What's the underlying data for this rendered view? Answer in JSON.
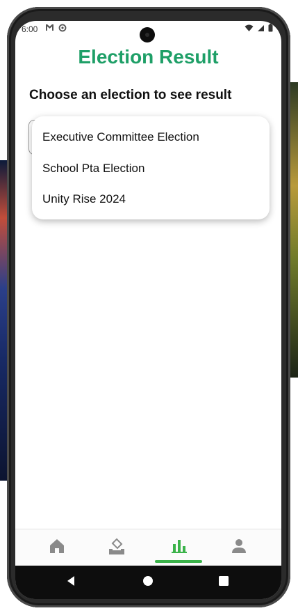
{
  "status_bar": {
    "time": "6:00",
    "left_icons": [
      "gmail-icon",
      "sync-icon"
    ],
    "right_icons": [
      "wifi-icon",
      "signal-icon",
      "battery-icon"
    ]
  },
  "header": {
    "title": "Election Result"
  },
  "main": {
    "prompt": "Choose an election to see result",
    "dropdown": {
      "options": [
        "Executive Committee Election",
        "School Pta Election",
        "Unity Rise 2024"
      ]
    }
  },
  "bottom_nav": {
    "items": [
      {
        "icon": "home-icon",
        "active": false
      },
      {
        "icon": "vote-icon",
        "active": false
      },
      {
        "icon": "bar-chart-icon",
        "active": true
      },
      {
        "icon": "person-icon",
        "active": false
      }
    ]
  },
  "system_nav": {
    "buttons": [
      "back-icon",
      "home-circle-icon",
      "recents-icon"
    ]
  },
  "colors": {
    "accent": "#1e9f67",
    "active_nav": "#3bb34a",
    "inactive_nav": "#8a8a8a"
  }
}
